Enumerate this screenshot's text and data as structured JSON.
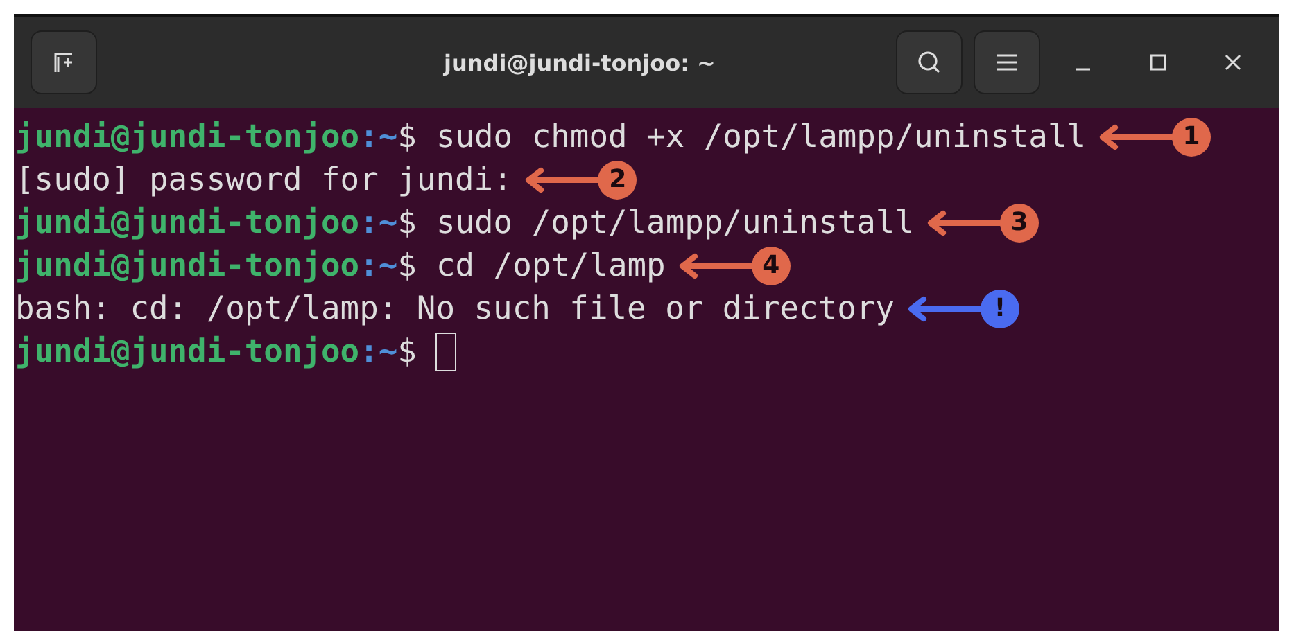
{
  "window": {
    "title": "jundi@jundi-tonjoo: ~"
  },
  "lines": [
    {
      "kind": "prompt",
      "user_host": "jundi@jundi-tonjoo",
      "path": ":~",
      "symbol": "$",
      "command": "sudo chmod +x /opt/lampp/uninstall",
      "callout": {
        "label": "1",
        "color": "#e0684b"
      }
    },
    {
      "kind": "output",
      "text": "[sudo] password for jundi:",
      "callout": {
        "label": "2",
        "color": "#e0684b"
      }
    },
    {
      "kind": "prompt",
      "user_host": "jundi@jundi-tonjoo",
      "path": ":~",
      "symbol": "$",
      "command": "sudo /opt/lampp/uninstall",
      "callout": {
        "label": "3",
        "color": "#e0684b"
      }
    },
    {
      "kind": "prompt",
      "user_host": "jundi@jundi-tonjoo",
      "path": ":~",
      "symbol": "$",
      "command": "cd /opt/lamp",
      "callout": {
        "label": "4",
        "color": "#e0684b"
      }
    },
    {
      "kind": "output",
      "text": "bash: cd: /opt/lamp: No such file or directory",
      "callout": {
        "label": "!",
        "color": "#4a6bf0"
      }
    },
    {
      "kind": "prompt",
      "user_host": "jundi@jundi-tonjoo",
      "path": ":~",
      "symbol": "$",
      "cursor": true
    }
  ]
}
